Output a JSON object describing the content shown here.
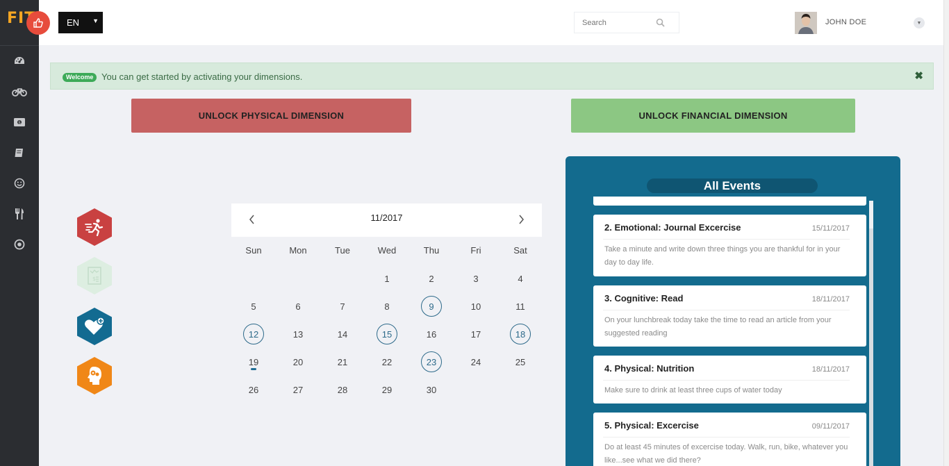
{
  "app": {
    "logo_text": "FIT"
  },
  "header": {
    "language": "EN",
    "search_placeholder": "Search",
    "user_name": "JOHN DOE"
  },
  "sidebar": {
    "items": [
      {
        "icon": "dashboard-icon"
      },
      {
        "icon": "bicycle-icon"
      },
      {
        "icon": "money-icon"
      },
      {
        "icon": "book-icon"
      },
      {
        "icon": "smile-icon"
      },
      {
        "icon": "utensils-icon"
      },
      {
        "icon": "target-icon"
      }
    ]
  },
  "alert": {
    "badge": "Welcome",
    "message": "You can get started by activating your dimensions.",
    "close": "✖"
  },
  "actions": {
    "unlock_physical": "UNLOCK PHYSICAL DIMENSION",
    "unlock_financial": "UNLOCK FINANCIAL DIMENSION"
  },
  "calendar": {
    "title": "11/2017",
    "weekdays": [
      "Sun",
      "Mon",
      "Tue",
      "Wed",
      "Thu",
      "Fri",
      "Sat"
    ],
    "days": [
      {
        "n": "1"
      },
      {
        "n": "2"
      },
      {
        "n": "3"
      },
      {
        "n": "4"
      },
      {
        "n": "5"
      },
      {
        "n": "6"
      },
      {
        "n": "7"
      },
      {
        "n": "8"
      },
      {
        "n": "9",
        "marked": true
      },
      {
        "n": "10"
      },
      {
        "n": "11"
      },
      {
        "n": "12",
        "marked": true
      },
      {
        "n": "13"
      },
      {
        "n": "14"
      },
      {
        "n": "15",
        "marked": true
      },
      {
        "n": "16"
      },
      {
        "n": "17"
      },
      {
        "n": "18",
        "marked": true
      },
      {
        "n": "19",
        "today": true
      },
      {
        "n": "20"
      },
      {
        "n": "21"
      },
      {
        "n": "22"
      },
      {
        "n": "23",
        "marked": true
      },
      {
        "n": "24"
      },
      {
        "n": "25"
      },
      {
        "n": "26"
      },
      {
        "n": "27"
      },
      {
        "n": "28"
      },
      {
        "n": "29"
      },
      {
        "n": "30"
      }
    ]
  },
  "events": {
    "title": "All Events",
    "items": [
      {
        "title": "2. Emotional: Journal Excercise",
        "date": "15/11/2017",
        "desc": "Take a minute and write down three things you are thankful for in your day to day life."
      },
      {
        "title": "3. Cognitive: Read",
        "date": "18/11/2017",
        "desc": "On your lunchbreak today take the time to read an article from your suggested reading"
      },
      {
        "title": "4. Physical: Nutrition",
        "date": "18/11/2017",
        "desc": "Make sure to drink at least three cups of water today"
      },
      {
        "title": "5. Physical: Excercise",
        "date": "09/11/2017",
        "desc": "Do at least 45 minutes of excercise today. Walk, run, bike, whatever you like...see what we did there?"
      }
    ]
  }
}
